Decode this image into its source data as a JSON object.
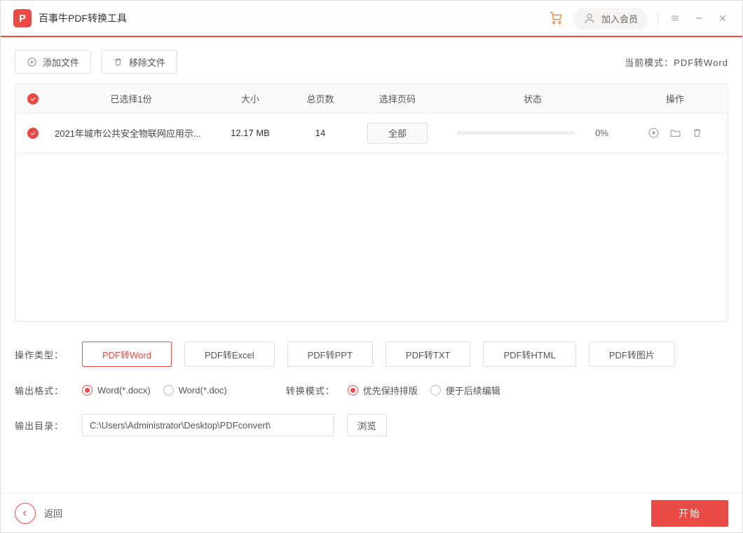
{
  "header": {
    "app_title": "百事牛PDF转换工具",
    "vip_label": "加入会员"
  },
  "toolbar": {
    "add_label": "添加文件",
    "remove_label": "移除文件",
    "mode_label": "当前模式：PDF转Word"
  },
  "table": {
    "headers": {
      "selected": "已选择1份",
      "size": "大小",
      "pages": "总页数",
      "range": "选择页码",
      "status": "状态",
      "action": "操作"
    },
    "rows": [
      {
        "name": "2021年城市公共安全物联网应用示...",
        "size": "12.17 MB",
        "pages": "14",
        "range": "全部",
        "progress_pct": "0%"
      }
    ]
  },
  "options": {
    "type_label": "操作类型：",
    "types": [
      "PDF转Word",
      "PDF转Excel",
      "PDF转PPT",
      "PDF转TXT",
      "PDF转HTML",
      "PDF转图片"
    ],
    "type_selected": 0,
    "format_label": "输出格式：",
    "formats": [
      "Word(*.docx)",
      "Word(*.doc)"
    ],
    "format_selected": 0,
    "convert_mode_label": "转换模式：",
    "convert_modes": [
      "优先保持排版",
      "便于后续编辑"
    ],
    "convert_mode_selected": 0,
    "output_dir_label": "输出目录：",
    "output_dir_value": "C:\\Users\\Administrator\\Desktop\\PDFconvert\\",
    "browse_label": "浏览"
  },
  "footer": {
    "back_label": "返回",
    "start_label": "开始"
  }
}
